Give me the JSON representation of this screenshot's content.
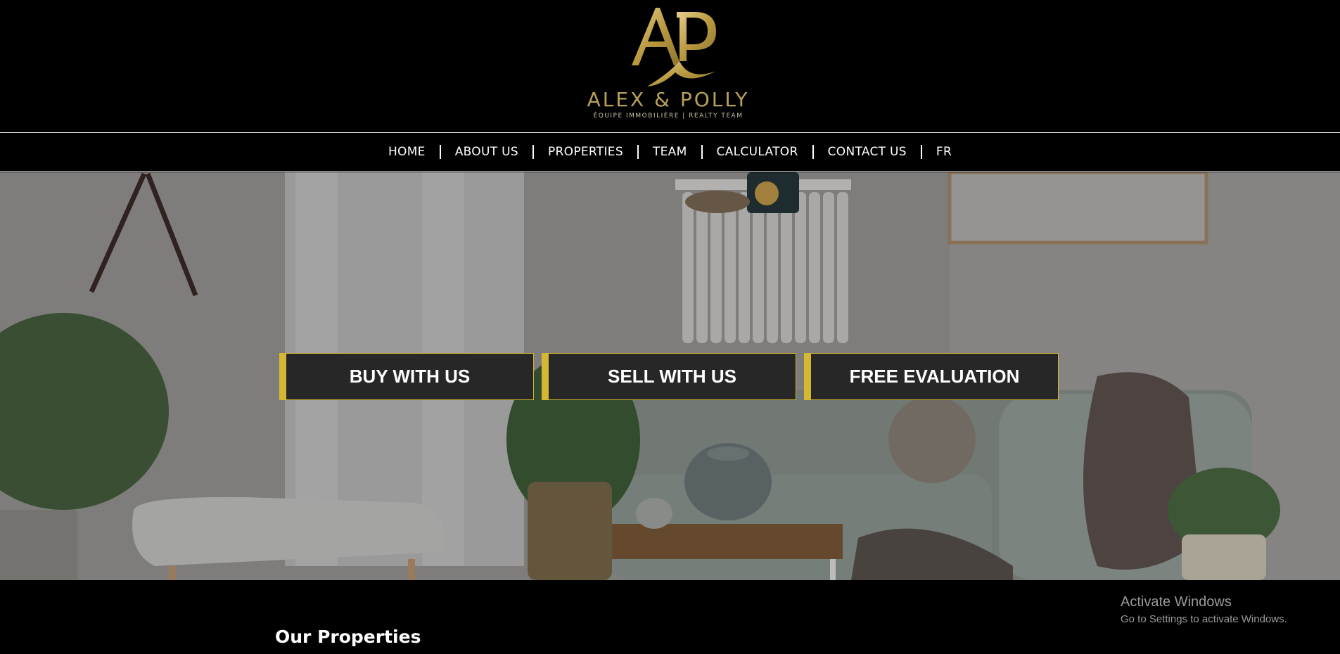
{
  "brand": {
    "monogram": "AP",
    "name": "ALEX & POLLY",
    "tagline": "ÉQUIPE IMMOBILIÈRE | REALTY TEAM",
    "gold": "#c2aa5e"
  },
  "nav": {
    "items": [
      "HOME",
      "ABOUT US",
      "PROPERTIES",
      "TEAM",
      "CALCULATOR",
      "CONTACT US",
      "FR"
    ]
  },
  "hero": {
    "buttons": [
      "BUY WITH US",
      "SELL WITH US",
      "FREE EVALUATION"
    ],
    "accent": "#d4b733",
    "button_bg": "#272727"
  },
  "section": {
    "title": "Our Properties"
  },
  "os_notice": {
    "title": "Activate Windows",
    "subtitle": "Go to Settings to activate Windows."
  }
}
